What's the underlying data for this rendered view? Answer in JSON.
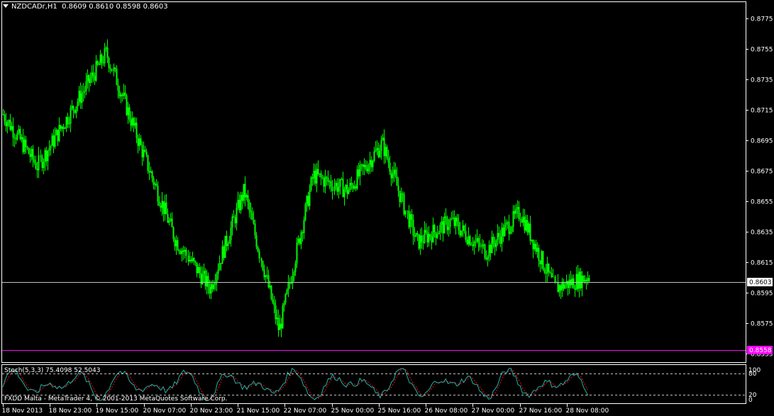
{
  "header": {
    "symbol_tf": "NZDCADr,H1",
    "ohlc": "0.8609 0.8610 0.8598 0.8603"
  },
  "price_axis": {
    "labels": [
      "0.8775",
      "0.8755",
      "0.8735",
      "0.8715",
      "0.8695",
      "0.8675",
      "0.8655",
      "0.8635",
      "0.8615",
      "0.8595",
      "0.8575",
      "0.8555"
    ],
    "current_price_label": "0.8603",
    "level_label": "0.8558"
  },
  "stochastic": {
    "title": "Stoch(5,3,3) 75.4098 52.5043",
    "levels": [
      "100",
      "80",
      "20",
      "0"
    ]
  },
  "time_axis": {
    "labels": [
      "18 Nov 2013",
      "18 Nov 23:00",
      "19 Nov 15:00",
      "20 Nov 07:00",
      "20 Nov 23:00",
      "21 Nov 15:00",
      "22 Nov 07:00",
      "25 Nov 00:00",
      "25 Nov 16:00",
      "26 Nov 08:00",
      "27 Nov 00:00",
      "27 Nov 16:00",
      "28 Nov 08:00"
    ]
  },
  "footer": {
    "copyright": "FXDD Malta - MetaTrader 4, © 2001-2013 MetaQuotes Software Corp."
  },
  "colors": {
    "background": "#000000",
    "candles": "#00ff00",
    "price_line": "#c0c0c0",
    "level_line": "#ff00ff",
    "stoch_main": "#20b2aa",
    "stoch_signal": "#ff0000"
  },
  "chart_data": {
    "type": "line",
    "ylim": [
      0.855,
      0.8785
    ],
    "current_price": 0.8603,
    "level": 0.8558,
    "x": [
      "18 Nov 2013",
      "18 Nov 23:00",
      "19 Nov 15:00",
      "20 Nov 07:00",
      "20 Nov 23:00",
      "21 Nov 15:00",
      "22 Nov 07:00",
      "25 Nov 00:00",
      "25 Nov 16:00",
      "26 Nov 08:00",
      "27 Nov 00:00",
      "27 Nov 16:00",
      "28 Nov 08:00"
    ],
    "series": [
      {
        "values": [
          0.8712,
          0.8678,
          0.8715,
          0.8752,
          0.869,
          0.863,
          0.8598,
          0.8662,
          0.857,
          0.8672,
          0.8662,
          0.8693,
          0.8628,
          0.8642,
          0.8622,
          0.8648,
          0.8598,
          0.8606
        ]
      }
    ]
  }
}
